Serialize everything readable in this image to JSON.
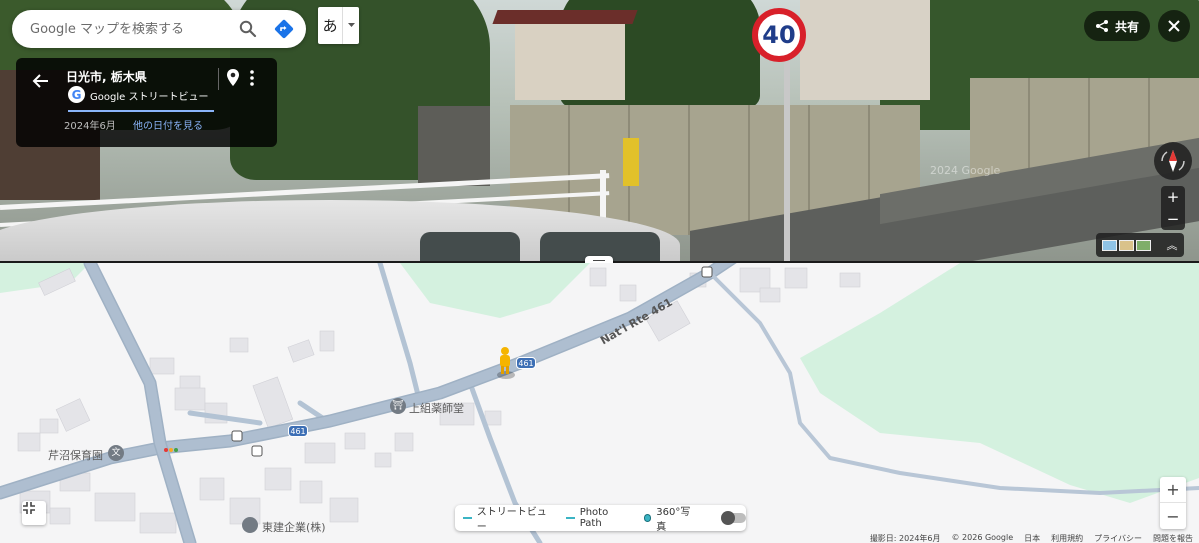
{
  "search": {
    "placeholder": "Google マップを検索する"
  },
  "ime": {
    "label": "あ"
  },
  "card": {
    "place": "日光市, 栃木県",
    "source": "Google ストリートビュー",
    "date": "2024年6月",
    "other_dates": "他の日付を見る"
  },
  "share": {
    "label": "共有"
  },
  "streetview": {
    "speed_sign": "40",
    "watermark": "2024 Google"
  },
  "map": {
    "labels": {
      "route_name": "Nat'l Rte 461",
      "shield": "461",
      "temple": "上組薬師堂",
      "nursery": "芹沼保育園",
      "company": "東建企業(株)"
    }
  },
  "legend": {
    "street_view": "ストリートビュー",
    "photo_path": "Photo Path",
    "photo360": "360°写真"
  },
  "attribution": {
    "imagery_date": "撮影日: 2024年6月",
    "copyright": "© 2026 Google",
    "country": "日本",
    "terms": "利用規約",
    "privacy": "プライバシー",
    "report": "問題を報告"
  },
  "colors": {
    "map_green": "#d4f1df",
    "road": "#aebed0",
    "route_blue": "#3d6fb5",
    "accent_link": "#8ab4f8"
  }
}
